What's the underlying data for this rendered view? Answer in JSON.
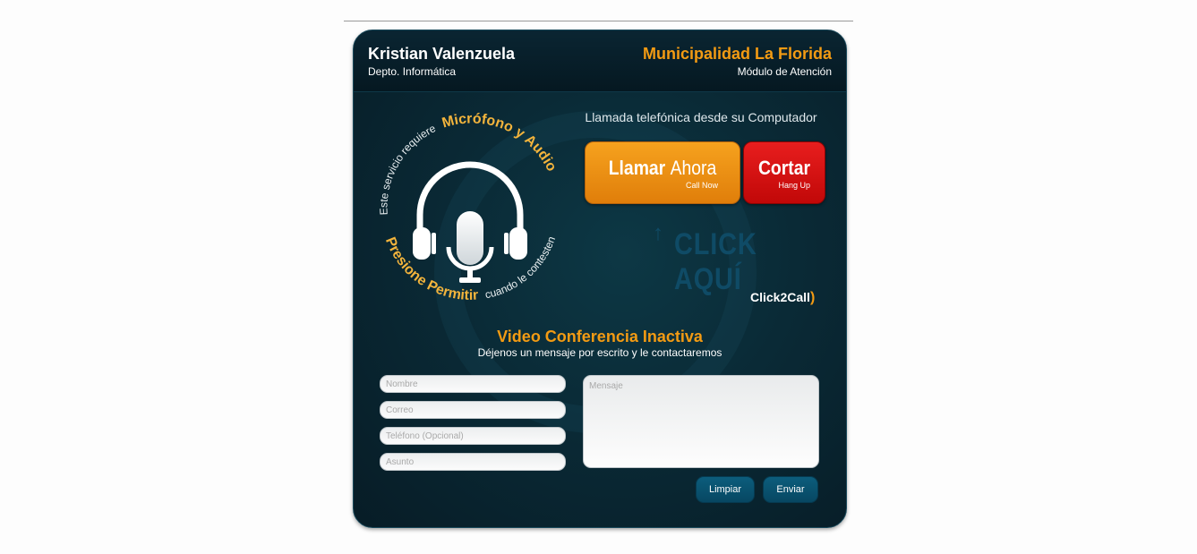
{
  "header": {
    "name": "Kristian Valenzuela",
    "department": "Depto. Informática",
    "organization": "Municipalidad La Florida",
    "module": "Módulo de Atención"
  },
  "ring": {
    "top_small": "Este servicio requiere",
    "top_bold": "Micrófono y Audio",
    "bottom_bold": "Presione Permitir",
    "bottom_small": "cuando le contesten"
  },
  "call": {
    "heading": "Llamada telefónica desde su Computador",
    "call_bold": "Llamar",
    "call_normal": "Ahora",
    "call_sub": "Call Now",
    "hang_label": "Cortar",
    "hang_sub": "Hang Up",
    "click_here": "CLICK AQUÍ",
    "logo": "Click2Call"
  },
  "video": {
    "title": "Video Conferencia Inactiva",
    "subtitle": "Déjenos un mensaje por escrito y le contactaremos"
  },
  "form": {
    "name_placeholder": "Nombre",
    "email_placeholder": "Correo",
    "phone_placeholder": "Teléfono (Opcional)",
    "subject_placeholder": "Asunto",
    "message_placeholder": "Mensaje",
    "clear_label": "Limpiar",
    "send_label": "Enviar"
  },
  "colors": {
    "accent": "#f39b13",
    "call_button": "#f6a21e",
    "hang_button": "#d61010",
    "panel": "#0a2a36"
  },
  "icons": [
    "headphones-icon",
    "microphone-icon",
    "up-arrow-icon",
    "phone-handset-icon"
  ]
}
